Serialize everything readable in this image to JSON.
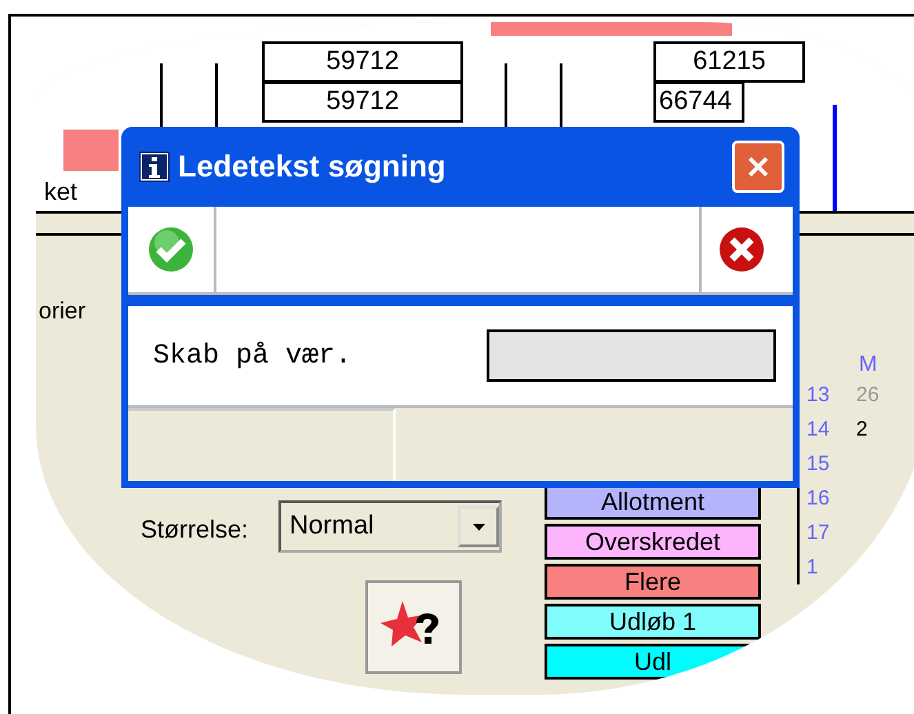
{
  "background": {
    "table_rows": [
      {
        "cells": [
          "59712",
          "61215"
        ]
      },
      {
        "cells": [
          "59712",
          "66744"
        ]
      }
    ],
    "side_label": "ket",
    "tab_label": "orier",
    "calendar": {
      "header": "M",
      "weeks": [
        {
          "week": "13",
          "day": "26"
        },
        {
          "week": "14",
          "day": "2"
        },
        {
          "week": "15"
        },
        {
          "week": "16"
        },
        {
          "week": "17"
        },
        {
          "week": "1"
        }
      ]
    },
    "legend": [
      {
        "label": "Allotment",
        "color": "#b4b4fc"
      },
      {
        "label": "Overskredet",
        "color": "#fcb4fc"
      },
      {
        "label": "Flere",
        "color": "#f88080"
      },
      {
        "label": "Udløb 1",
        "color": "#80fcfc"
      },
      {
        "label": "Udl",
        "color": "#00fcfc"
      }
    ],
    "size": {
      "label": "Størrelse:",
      "value": "Normal"
    }
  },
  "dialog": {
    "title": "Ledetekst søgning",
    "field": {
      "label": "Skab på vær."
    }
  }
}
